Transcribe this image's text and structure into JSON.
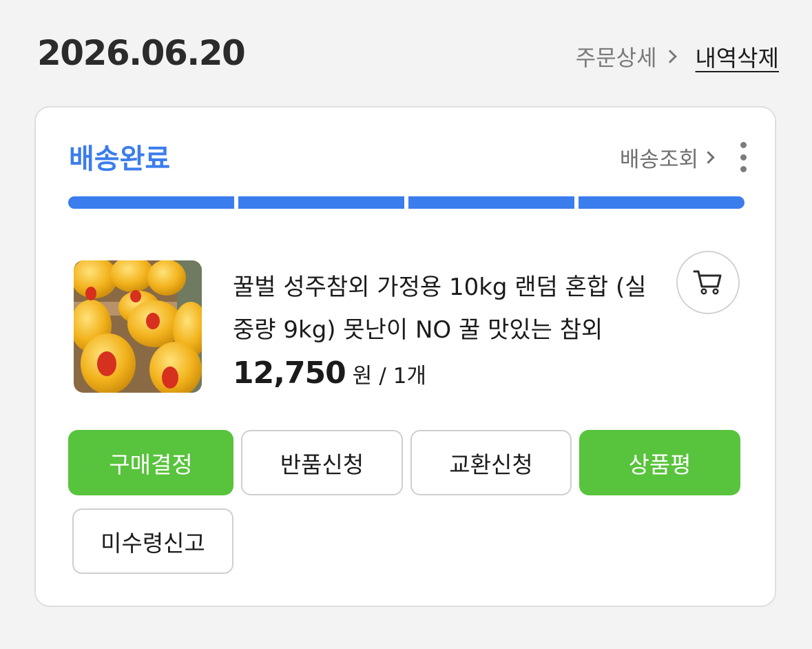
{
  "order": {
    "date": "2026.06.20",
    "detail_label": "주문상세",
    "delete_label": "내역삭제"
  },
  "card": {
    "status": "배송완료",
    "track_label": "배송조회",
    "progress": {
      "completed_steps": 4,
      "total_steps": 4
    },
    "accent_color": "#3b7ded",
    "product": {
      "name": "꿀벌 성주참외 가정용 10kg 랜덤 혼합 (실중량 9kg) 못난이 NO 꿀 맛있는 참외",
      "price": "12,750",
      "currency": "원",
      "separator": "/",
      "quantity": "1개"
    },
    "cart_icon": "cart-icon",
    "buttons": {
      "confirm": "구매결정",
      "return": "반품신청",
      "exchange": "교환신청",
      "review": "상품평",
      "not_received": "미수령신고"
    },
    "button_color": "#58c33c"
  }
}
